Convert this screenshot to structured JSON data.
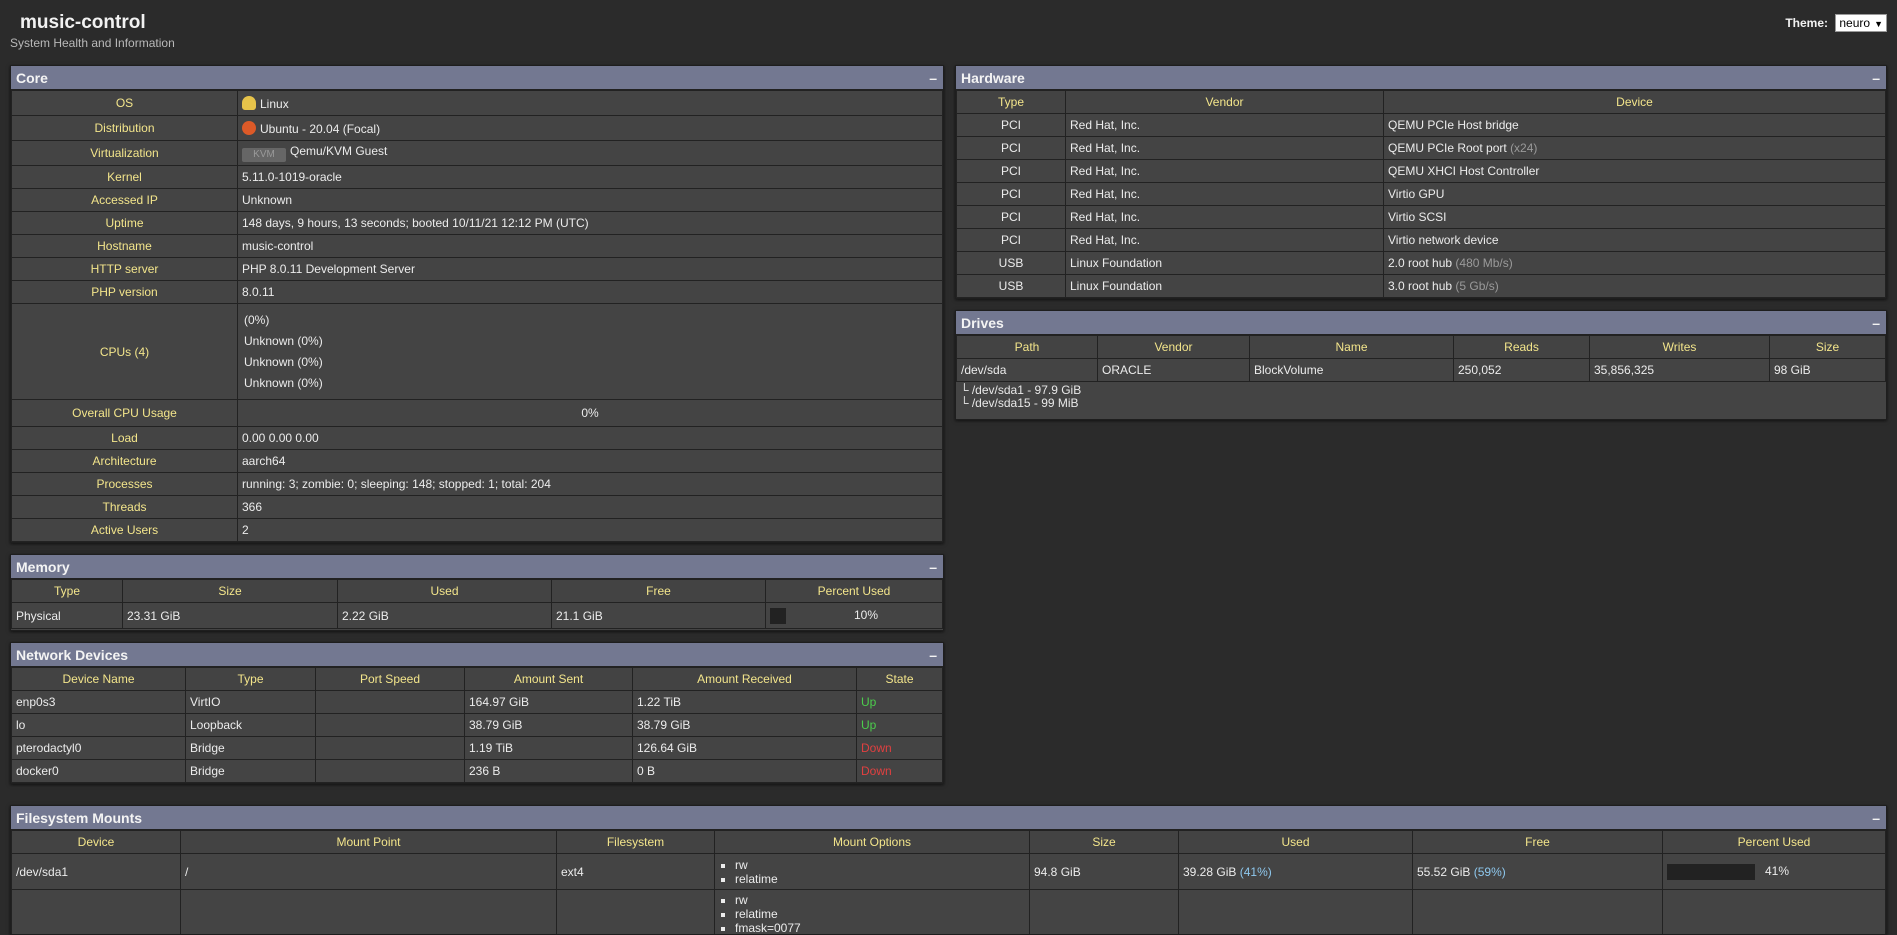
{
  "header": {
    "title": "music-control",
    "subtitle": "System Health and Information",
    "theme_label": "Theme:",
    "theme_value": "neuro"
  },
  "core": {
    "title": "Core",
    "collapse": "–",
    "rows": {
      "os": {
        "label": "OS",
        "value": "Linux"
      },
      "distribution": {
        "label": "Distribution",
        "value": "Ubuntu - 20.04 (Focal)"
      },
      "virtualization": {
        "label": "Virtualization",
        "value": "Qemu/KVM Guest",
        "icon_text": "KVM"
      },
      "kernel": {
        "label": "Kernel",
        "value": "5.11.0-1019-oracle"
      },
      "accessed_ip": {
        "label": "Accessed IP",
        "value": "Unknown"
      },
      "uptime": {
        "label": "Uptime",
        "value": "148 days, 9 hours, 13 seconds; booted 10/11/21 12:12 PM (UTC)"
      },
      "hostname": {
        "label": "Hostname",
        "value": "music-control"
      },
      "http_server": {
        "label": "HTTP server",
        "value": "PHP 8.0.11 Development Server"
      },
      "php_version": {
        "label": "PHP version",
        "value": "8.0.11"
      },
      "cpus": {
        "label": "CPUs (4)",
        "lines": [
          "(0%)",
          "Unknown (0%)",
          "Unknown (0%)",
          "Unknown (0%)"
        ]
      },
      "cpu_usage": {
        "label": "Overall CPU Usage",
        "value": "0%"
      },
      "load": {
        "label": "Load",
        "value": "0.00 0.00 0.00"
      },
      "architecture": {
        "label": "Architecture",
        "value": "aarch64"
      },
      "processes": {
        "label": "Processes",
        "value": "running: 3; zombie: 0; sleeping: 148; stopped: 1; total: 204"
      },
      "threads": {
        "label": "Threads",
        "value": "366"
      },
      "active_users": {
        "label": "Active Users",
        "value": "2"
      }
    }
  },
  "memory": {
    "title": "Memory",
    "collapse": "–",
    "headers": [
      "Type",
      "Size",
      "Used",
      "Free",
      "Percent Used"
    ],
    "row": {
      "type": "Physical",
      "size": "23.31 GiB",
      "used": "2.22 GiB",
      "free": "21.1 GiB",
      "percent": "10%"
    }
  },
  "network": {
    "title": "Network Devices",
    "collapse": "–",
    "headers": [
      "Device Name",
      "Type",
      "Port Speed",
      "Amount Sent",
      "Amount Received",
      "State"
    ],
    "rows": [
      {
        "name": "enp0s3",
        "type": "VirtIO",
        "speed": "",
        "sent": "164.97 GiB",
        "received": "1.22 TiB",
        "state": "Up"
      },
      {
        "name": "lo",
        "type": "Loopback",
        "speed": "",
        "sent": "38.79 GiB",
        "received": "38.79 GiB",
        "state": "Up"
      },
      {
        "name": "pterodactyl0",
        "type": "Bridge",
        "speed": "",
        "sent": "1.19 TiB",
        "received": "126.64 GiB",
        "state": "Down"
      },
      {
        "name": "docker0",
        "type": "Bridge",
        "speed": "",
        "sent": "236 B",
        "received": "0 B",
        "state": "Down"
      }
    ]
  },
  "hardware": {
    "title": "Hardware",
    "collapse": "–",
    "headers": [
      "Type",
      "Vendor",
      "Device"
    ],
    "rows": [
      {
        "type": "PCI",
        "vendor": "Red Hat, Inc.",
        "device": "QEMU PCIe Host bridge",
        "extra": ""
      },
      {
        "type": "PCI",
        "vendor": "Red Hat, Inc.",
        "device": "QEMU PCIe Root port",
        "extra": "(x24)"
      },
      {
        "type": "PCI",
        "vendor": "Red Hat, Inc.",
        "device": "QEMU XHCI Host Controller",
        "extra": ""
      },
      {
        "type": "PCI",
        "vendor": "Red Hat, Inc.",
        "device": "Virtio GPU",
        "extra": ""
      },
      {
        "type": "PCI",
        "vendor": "Red Hat, Inc.",
        "device": "Virtio SCSI",
        "extra": ""
      },
      {
        "type": "PCI",
        "vendor": "Red Hat, Inc.",
        "device": "Virtio network device",
        "extra": ""
      },
      {
        "type": "USB",
        "vendor": "Linux Foundation",
        "device": "2.0 root hub",
        "extra": "(480 Mb/s)"
      },
      {
        "type": "USB",
        "vendor": "Linux Foundation",
        "device": "3.0 root hub",
        "extra": "(5 Gb/s)"
      }
    ]
  },
  "drives": {
    "title": "Drives",
    "collapse": "–",
    "headers": [
      "Path",
      "Vendor",
      "Name",
      "Reads",
      "Writes",
      "Size"
    ],
    "row": {
      "path": "/dev/sda",
      "vendor": "ORACLE",
      "name": "BlockVolume",
      "reads": "250,052",
      "writes": "35,856,325",
      "size": "98 GiB"
    },
    "partitions": [
      "└ /dev/sda1 - 97.9 GiB",
      "└ /dev/sda15 - 99 MiB"
    ]
  },
  "filesystem": {
    "title": "Filesystem Mounts",
    "collapse": "–",
    "headers": [
      "Device",
      "Mount Point",
      "Filesystem",
      "Mount Options",
      "Size",
      "Used",
      "Free",
      "Percent Used"
    ],
    "rows": [
      {
        "device": "/dev/sda1",
        "mount": "/",
        "fs": "ext4",
        "options": [
          "rw",
          "relatime"
        ],
        "size": "94.8 GiB",
        "used": "39.28 GiB",
        "used_pct": "(41%)",
        "free": "55.52 GiB",
        "free_pct": "(59%)",
        "percent": "41%"
      },
      {
        "device": "",
        "mount": "",
        "fs": "",
        "options": [
          "rw",
          "relatime",
          "fmask=0077"
        ],
        "size": "",
        "used": "",
        "used_pct": "",
        "free": "",
        "free_pct": "",
        "percent": ""
      }
    ]
  }
}
